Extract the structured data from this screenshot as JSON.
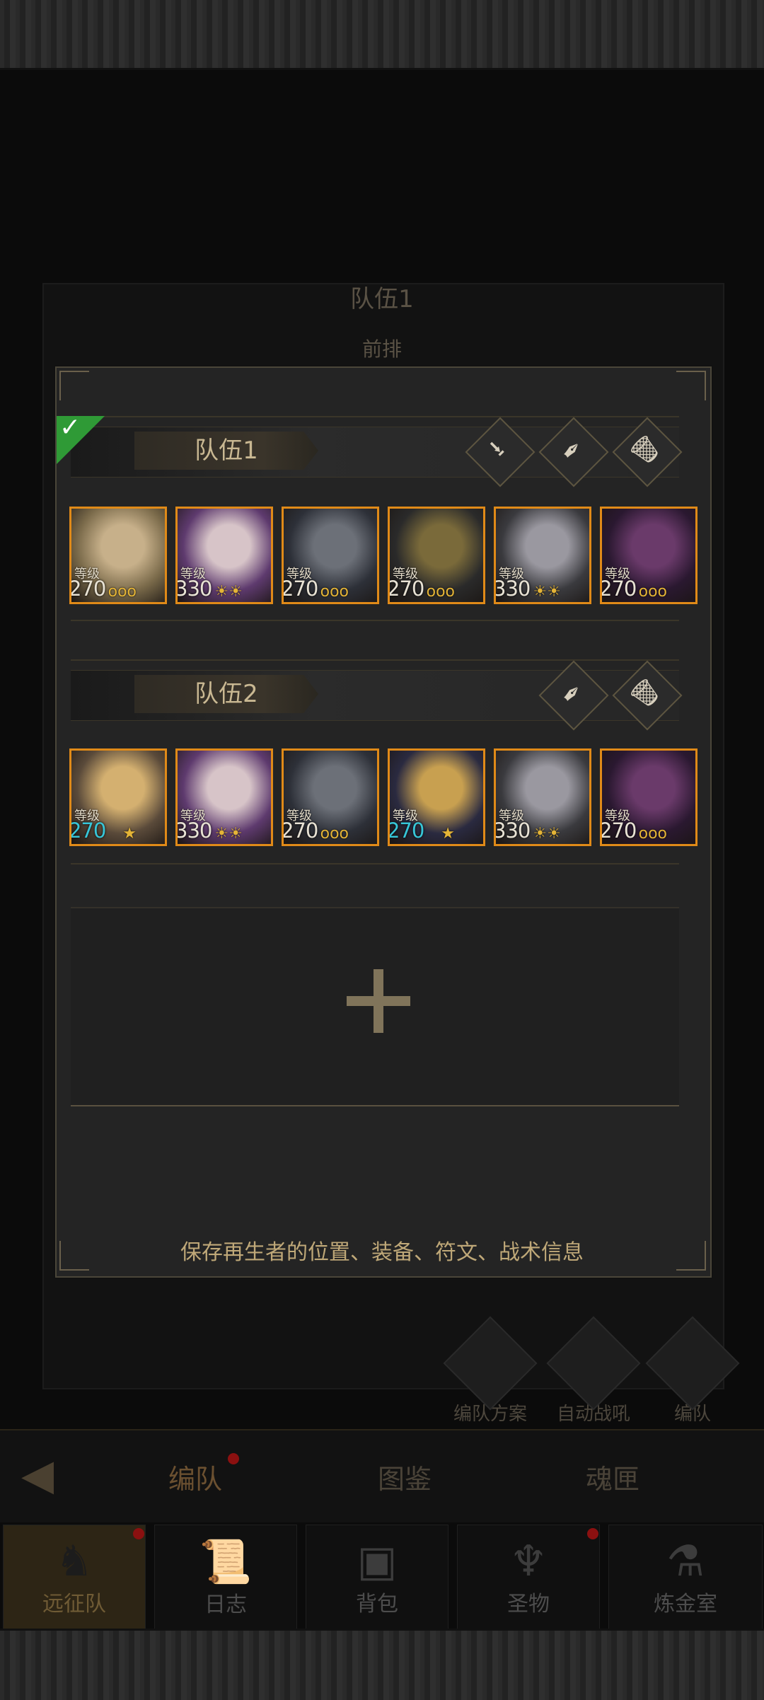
{
  "background": {
    "title": "队伍1",
    "subtitle": "前排",
    "side_buttons": [
      {
        "label": "编队方案",
        "icon": "helmet-icon"
      },
      {
        "label": "自动战吼",
        "icon": "auto-battle-icon"
      },
      {
        "label": "编队",
        "icon": "formation-icon"
      }
    ],
    "tabs": [
      {
        "label": "编队",
        "active": true,
        "badge": true
      },
      {
        "label": "图鉴",
        "active": false,
        "badge": false
      },
      {
        "label": "魂匣",
        "active": false,
        "badge": false
      }
    ],
    "bottom_nav": [
      {
        "label": "远征队",
        "icon": "horned-helmet-icon",
        "active": true,
        "badge": true
      },
      {
        "label": "日志",
        "icon": "scroll-icon",
        "active": false,
        "badge": false
      },
      {
        "label": "背包",
        "icon": "backpack-icon",
        "active": false,
        "badge": false
      },
      {
        "label": "圣物",
        "icon": "chalice-icon",
        "active": false,
        "badge": true
      },
      {
        "label": "炼金室",
        "icon": "alchemy-icon",
        "active": false,
        "badge": false
      }
    ]
  },
  "modal": {
    "teams": [
      {
        "name": "队伍1",
        "selected": true,
        "actions": [
          "download-icon",
          "quill-icon",
          "trash-icon"
        ],
        "heroes": [
          {
            "level_label": "等级",
            "level": "270",
            "blue": false,
            "rank": "ooo",
            "colors": [
              "#7a6a4a",
              "#c7b08a"
            ]
          },
          {
            "level_label": "等级",
            "level": "330",
            "blue": false,
            "rank": "☀☀",
            "colors": [
              "#5e3a6e",
              "#d7c4c8"
            ]
          },
          {
            "level_label": "等级",
            "level": "270",
            "blue": false,
            "rank": "ooo",
            "colors": [
              "#2d3038",
              "#6c7078"
            ]
          },
          {
            "level_label": "等级",
            "level": "270",
            "blue": false,
            "rank": "ooo",
            "colors": [
              "#2a2a2a",
              "#7a6a3a"
            ]
          },
          {
            "level_label": "等级",
            "level": "330",
            "blue": false,
            "rank": "☀☀",
            "colors": [
              "#3a3a3e",
              "#9a98a0"
            ]
          },
          {
            "level_label": "等级",
            "level": "270",
            "blue": false,
            "rank": "ooo",
            "colors": [
              "#2a1830",
              "#6a3a6a"
            ]
          }
        ]
      },
      {
        "name": "队伍2",
        "selected": false,
        "actions": [
          "quill-icon",
          "trash-icon"
        ],
        "heroes": [
          {
            "level_label": "等级",
            "level": "270",
            "blue": true,
            "rank": "★",
            "colors": [
              "#5a4a3a",
              "#d4b070"
            ]
          },
          {
            "level_label": "等级",
            "level": "330",
            "blue": false,
            "rank": "☀☀",
            "colors": [
              "#5e3a6e",
              "#d7c4c8"
            ]
          },
          {
            "level_label": "等级",
            "level": "270",
            "blue": false,
            "rank": "ooo",
            "colors": [
              "#2d3038",
              "#6c7078"
            ]
          },
          {
            "level_label": "等级",
            "level": "270",
            "blue": true,
            "rank": "★",
            "colors": [
              "#2a2a40",
              "#c8a050"
            ]
          },
          {
            "level_label": "等级",
            "level": "330",
            "blue": false,
            "rank": "☀☀",
            "colors": [
              "#3a3a3e",
              "#9a98a0"
            ]
          },
          {
            "level_label": "等级",
            "level": "270",
            "blue": false,
            "rank": "ooo",
            "colors": [
              "#2a1830",
              "#6a3a6a"
            ]
          }
        ]
      }
    ],
    "add_team_icon": "plus-icon",
    "footnote": "保存再生者的位置、装备、符文、战术信息"
  },
  "colors": {
    "frame": "#e08a18",
    "selected": "#2f9a36",
    "blue_level": "#37c6d8",
    "text": "#bfa878"
  }
}
